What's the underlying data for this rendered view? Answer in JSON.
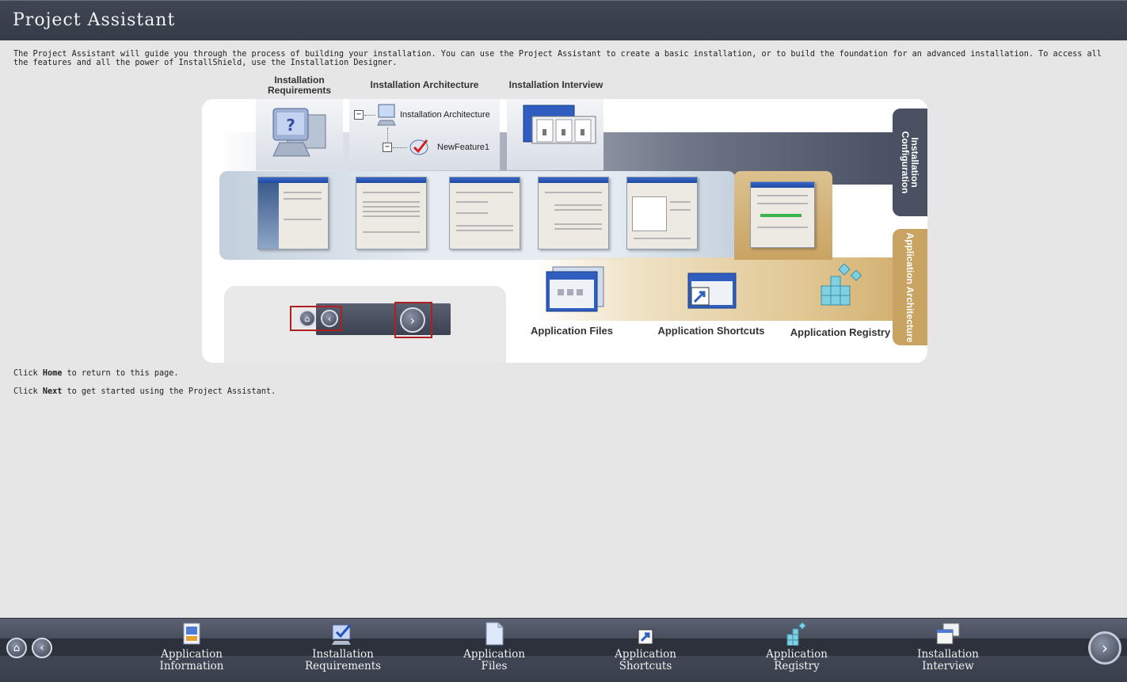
{
  "window": {
    "title": "Project Assistant"
  },
  "intro": "The Project Assistant will guide you through the process of building your installation. You can use the Project Assistant to create a basic installation, or to build the foundation for an advanced installation. To access all the features and all the power of InstallShield, use the Installation Designer.",
  "diagram": {
    "headers": {
      "requirements": "Installation Requirements",
      "architecture": "Installation Architecture",
      "interview": "Installation Interview"
    },
    "tree": {
      "root": "Installation Architecture",
      "child": "NewFeature1"
    },
    "side_tabs": {
      "configuration": "Installation Configuration",
      "app_architecture": "Application Architecture"
    },
    "app_items": [
      "Application Files",
      "Application Shortcuts",
      "Application Registry"
    ]
  },
  "hints": {
    "home": {
      "prefix": "Click ",
      "key": "Home",
      "suffix": " to return to this page."
    },
    "next": {
      "prefix": "Click ",
      "key": "Next",
      "suffix": " to get started using the Project Assistant."
    }
  },
  "bottom_nav": {
    "items": [
      {
        "line1": "Application",
        "line2": "Information",
        "icon": "app-info-icon"
      },
      {
        "line1": "Installation",
        "line2": "Requirements",
        "icon": "install-req-icon"
      },
      {
        "line1": "Application",
        "line2": "Files",
        "icon": "app-files-icon"
      },
      {
        "line1": "Application",
        "line2": "Shortcuts",
        "icon": "app-shortcuts-icon"
      },
      {
        "line1": "Application",
        "line2": "Registry",
        "icon": "app-registry-icon"
      },
      {
        "line1": "Installation",
        "line2": "Interview",
        "icon": "install-interview-icon"
      }
    ]
  },
  "colors": {
    "titlebar": "#3a404d",
    "gold": "#d1ae6c",
    "slate": "#4a5163",
    "highlight_box": "#b02020"
  }
}
